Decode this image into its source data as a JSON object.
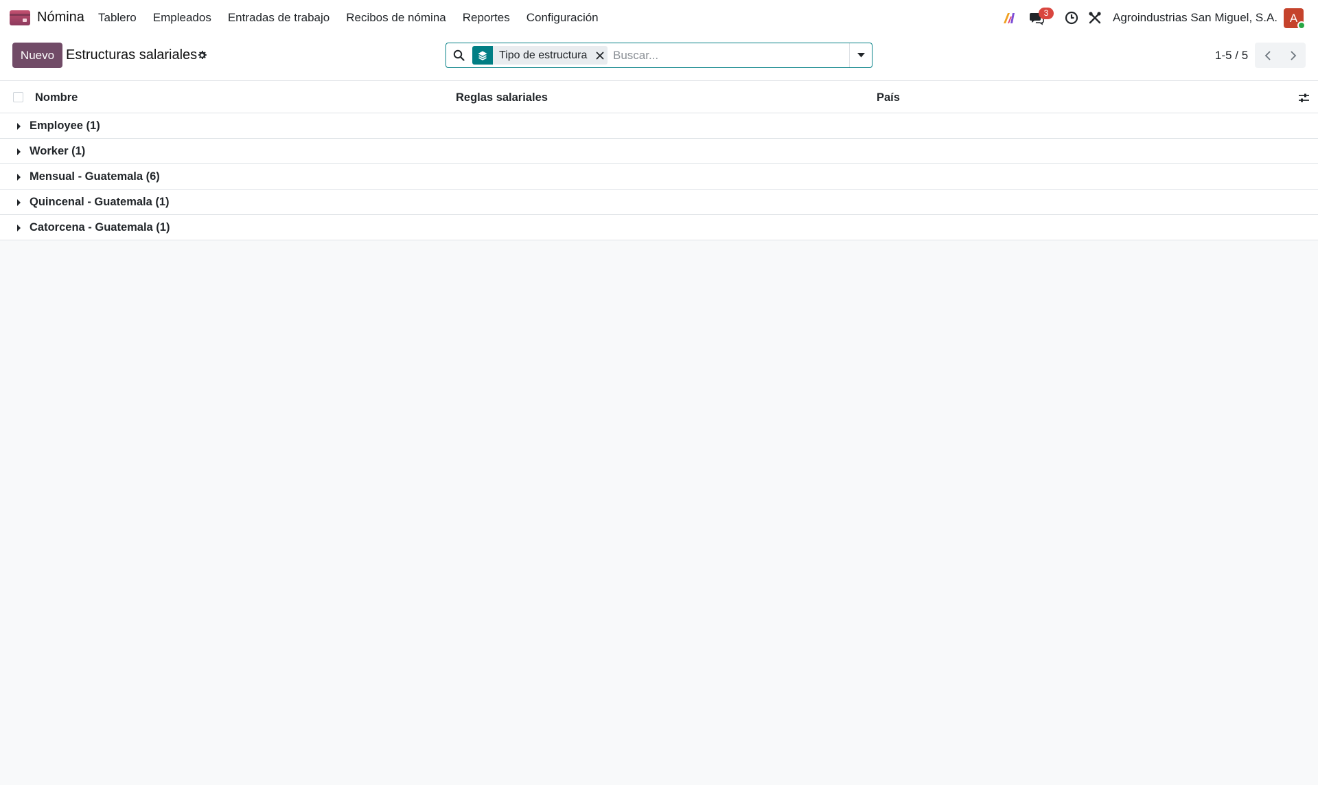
{
  "navbar": {
    "app_name": "Nómina",
    "menu": [
      "Tablero",
      "Empleados",
      "Entradas de trabajo",
      "Recibos de nómina",
      "Reportes",
      "Configuración"
    ],
    "chat_badge": "3",
    "company": "Agroindustrias San Miguel, S.A.",
    "avatar_initial": "A",
    "icons": [
      "ai-icon",
      "chat-icon",
      "clock-icon",
      "tools-icon"
    ]
  },
  "control_panel": {
    "new_button": "Nuevo",
    "title": "Estructuras salariales",
    "search": {
      "facet_label": "Tipo de estructura",
      "placeholder": "Buscar..."
    },
    "pager": "1-5 / 5"
  },
  "list": {
    "columns": [
      "Nombre",
      "Reglas salariales",
      "País"
    ],
    "groups": [
      "Employee (1)",
      "Worker (1)",
      "Mensual - Guatemala (6)",
      "Quincenal - Guatemala (1)",
      "Catorcena - Guatemala (1)"
    ]
  },
  "colors": {
    "brand": "#714b67",
    "accent": "#017e84",
    "badge": "#d9463f",
    "avatar": "#c5432c"
  }
}
